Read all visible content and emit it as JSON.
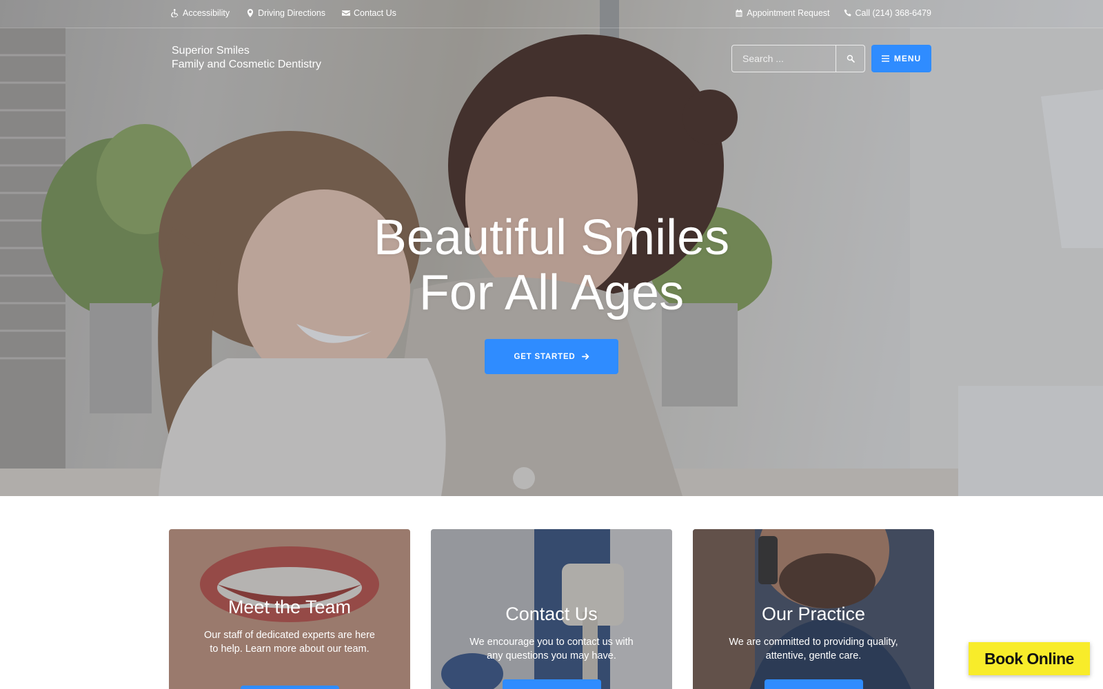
{
  "topbar": {
    "accessibility": "Accessibility",
    "directions": "Driving Directions",
    "contact": "Contact Us",
    "appointment": "Appointment Request",
    "call": "Call (214) 368-6479"
  },
  "brand": {
    "line1": "Superior Smiles",
    "line2": "Family and Cosmetic Dentistry"
  },
  "search": {
    "placeholder": "Search ..."
  },
  "menu": {
    "label": "MENU"
  },
  "hero": {
    "headline_line1": "Beautiful Smiles",
    "headline_line2": "For All Ages",
    "cta_label": "GET STARTED"
  },
  "cards": [
    {
      "title": "Meet the Team",
      "text": "Our staff of dedicated experts are here to help. Learn more about our team."
    },
    {
      "title": "Contact Us",
      "text": "We encourage you to contact us with any questions you may have."
    },
    {
      "title": "Our Practice",
      "text": "We are committed to providing quality, attentive, gentle care."
    }
  ],
  "book_online": {
    "label": "Book Online"
  },
  "colors": {
    "accent": "#2f8cff",
    "book_button": "#f8ec2a"
  },
  "icons": {
    "accessibility": "wheelchair-icon",
    "directions": "map-marker-icon",
    "contact": "envelope-icon",
    "appointment": "calendar-icon",
    "call": "phone-icon",
    "search": "search-icon",
    "menu": "hamburger-icon",
    "cta": "arrow-right-icon"
  }
}
